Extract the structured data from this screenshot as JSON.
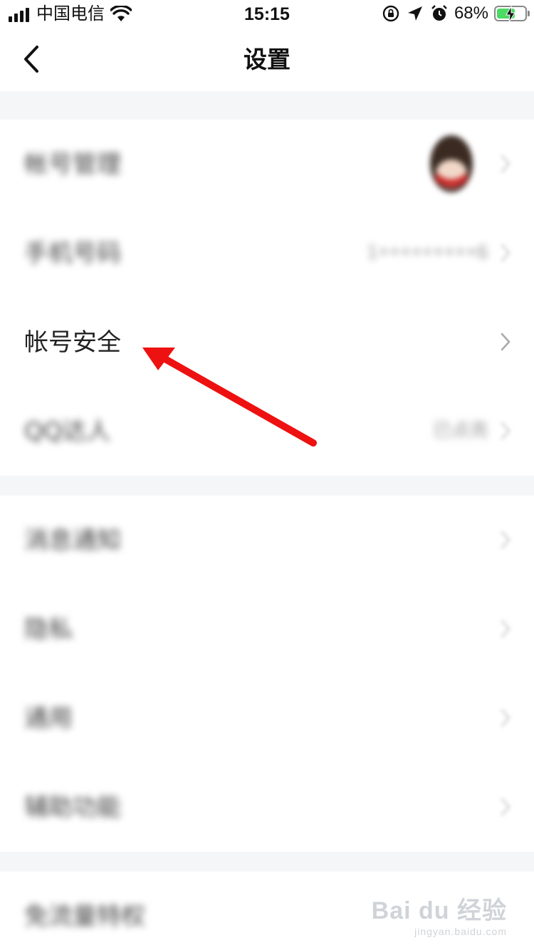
{
  "status_bar": {
    "carrier": "中国电信",
    "time": "15:15",
    "battery_percent": "68%",
    "battery_level": 0.68,
    "battery_color": "#4cd964",
    "icons": [
      "signal-icon",
      "wifi-icon",
      "rotation-lock-icon",
      "location-icon",
      "alarm-icon",
      "battery-icon"
    ]
  },
  "nav": {
    "title": "设置",
    "back_icon": "chevron-left-icon"
  },
  "groups": [
    {
      "items": [
        {
          "label": "帐号管理",
          "blurred": true,
          "has_avatar": true
        },
        {
          "label": "手机号码",
          "blurred": true,
          "value": "1•••••••••6"
        },
        {
          "label": "帐号安全",
          "blurred": false,
          "highlighted": true
        },
        {
          "label": "QQ达人",
          "blurred": true,
          "value": "已点亮"
        }
      ]
    },
    {
      "items": [
        {
          "label": "消息通知",
          "blurred": true
        },
        {
          "label": "隐私",
          "blurred": true
        },
        {
          "label": "通用",
          "blurred": true
        },
        {
          "label": "辅助功能",
          "blurred": true
        }
      ]
    },
    {
      "items": [
        {
          "label": "免流量特权",
          "blurred": true
        }
      ]
    }
  ],
  "annotation": {
    "arrow_color": "#ee1111",
    "points_to": "帐号安全"
  },
  "watermark": {
    "logo": "Bai du 经验",
    "url": "jingyan.baidu.com"
  }
}
